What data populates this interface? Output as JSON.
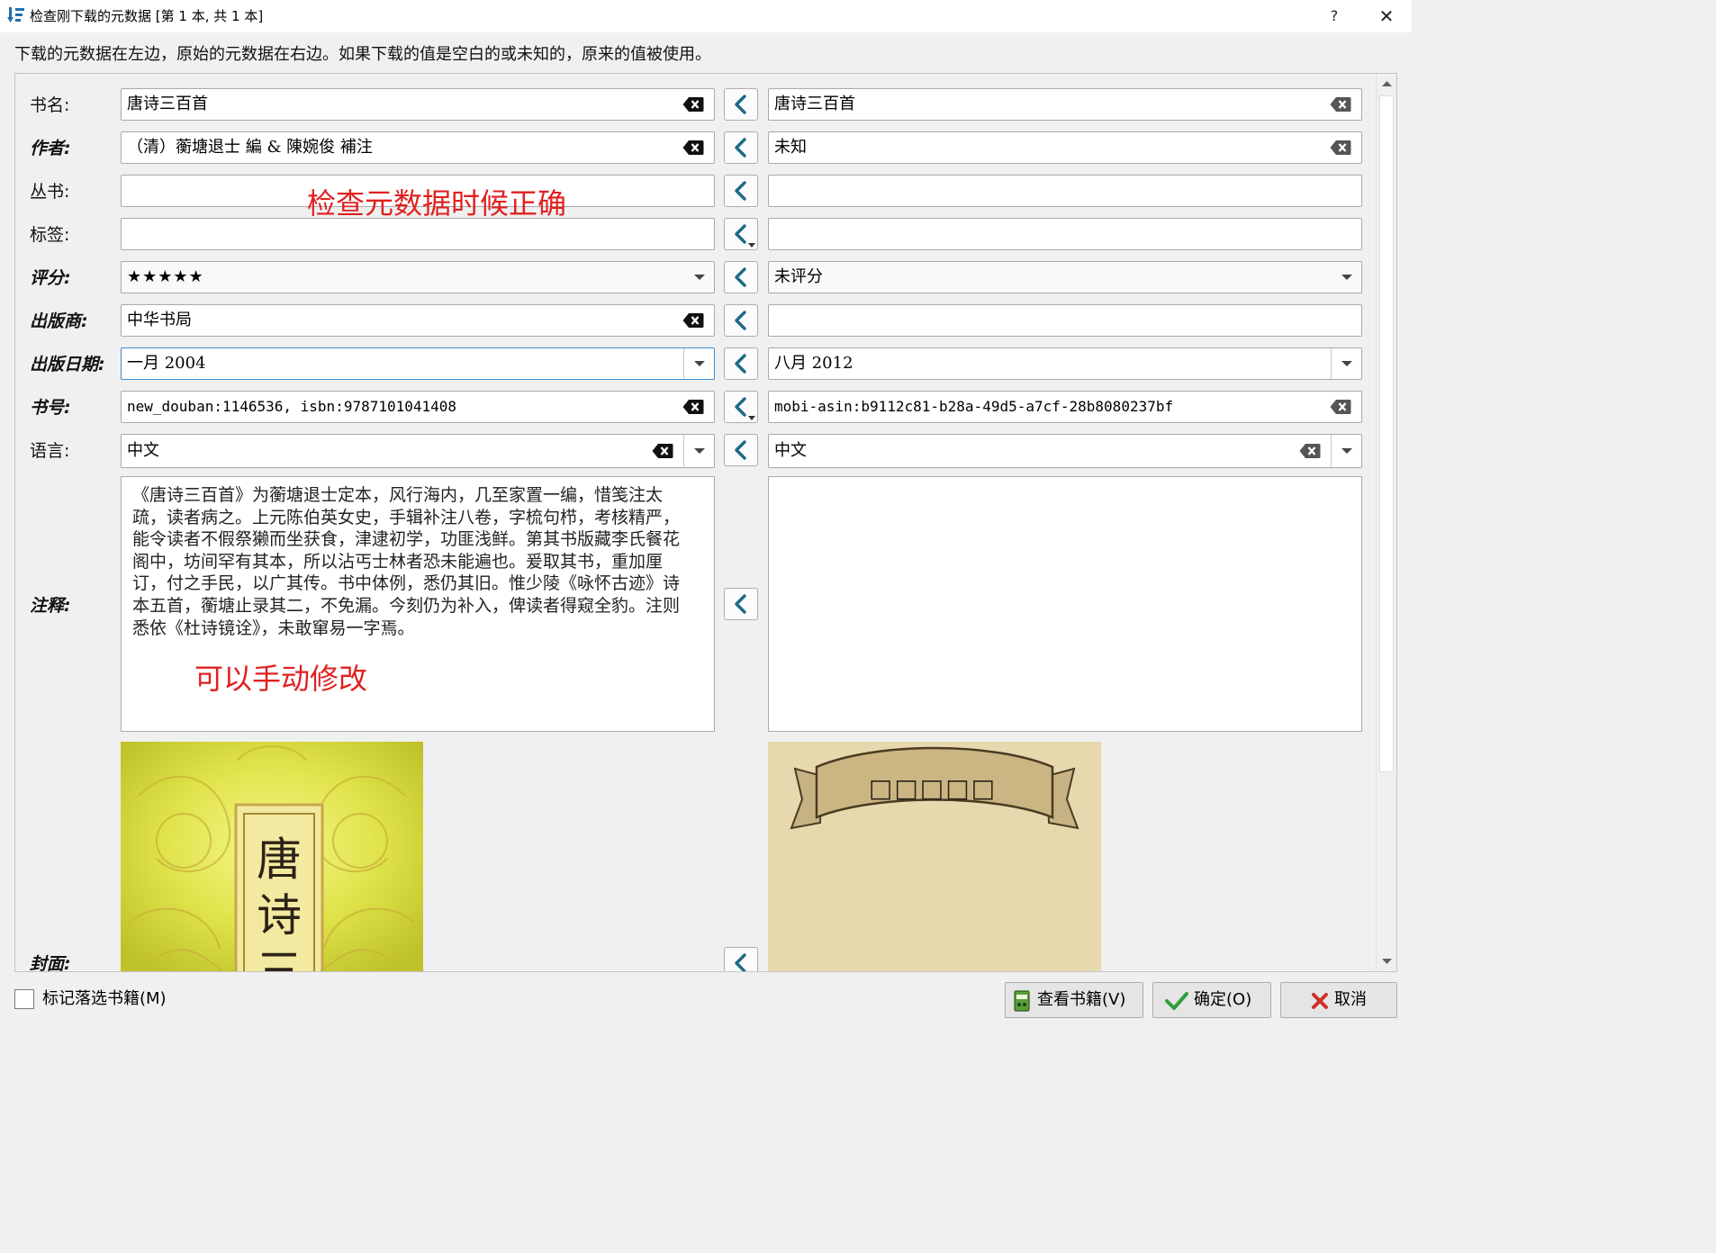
{
  "window": {
    "title": "检查刚下载的元数据 [第 1 本, 共 1 本]",
    "help": "?",
    "close": "✕"
  },
  "instruction": "下载的元数据在左边，原始的元数据在右边。如果下载的值是空白的或未知的，原来的值被使用。",
  "labels": {
    "title": "书名:",
    "authors": "作者:",
    "series": "丛书:",
    "tags": "标签:",
    "rating": "评分:",
    "publisher": "出版商:",
    "pubdate": "出版日期:",
    "identifiers": "书号:",
    "languages": "语言:",
    "comments": "注释:",
    "cover": "封面:"
  },
  "downloaded": {
    "title": "唐诗三百首",
    "authors": "（清）蘅塘退士 編 & 陳婉俊 補注",
    "series": "",
    "tags": "",
    "rating": "★★★★★",
    "publisher": "中华书局",
    "pubdate": "一月 2004",
    "identifiers": "new_douban:1146536, isbn:9787101041408",
    "languages": "中文",
    "comments": "《唐诗三百首》为蘅塘退士定本，风行海内，几至家置一编，惜笺注太疏，读者病之。上元陈伯英女史，手辑补注八卷，字梳句栉，考核精严，能令读者不假祭獭而坐获食，津逮初学，功匪浅鲜。第其书版藏李氏餐花阁中，坊间罕有其本，所以沾丐士林者恐未能遍也。爰取其书，重加厘订，付之手民，以广其传。书中体例，悉仍其旧。惟少陵《咏怀古迹》诗本五首，蘅塘止录其二，不免漏。今刻仍为补入，俾读者得窥全豹。注则悉依《杜诗镜诠》，未敢窜易一字焉。",
    "cover_text": "唐诗三"
  },
  "original": {
    "title": "唐诗三百首",
    "authors": "未知",
    "series": "",
    "tags": "",
    "rating": "未评分",
    "publisher": "",
    "pubdate": "八月 2012",
    "identifiers": "mobi-asin:b9112c81-b28a-49d5-a7cf-28b8080237bf",
    "languages": "中文",
    "comments": "",
    "cover_banner": "□□□□□"
  },
  "annotations": {
    "note1": "检查元数据时候正确",
    "note2": "可以手动修改"
  },
  "footer": {
    "mark_checkbox": "标记落选书籍(M)",
    "view_book": "查看书籍(V)",
    "ok": "确定(O)",
    "cancel": "取消"
  },
  "colors": {
    "accent": "#1f6fb5",
    "copy_arrow": "#1a6a87",
    "annotation_red": "#e02020",
    "ok_check": "#2e9e3e",
    "cancel_x": "#d0302a"
  },
  "icons": [
    "app-icon",
    "clear-icon",
    "chevron-down-icon",
    "arrow-left-icon",
    "book-icon",
    "check-icon",
    "x-icon",
    "scroll-up-icon",
    "scroll-down-icon"
  ]
}
